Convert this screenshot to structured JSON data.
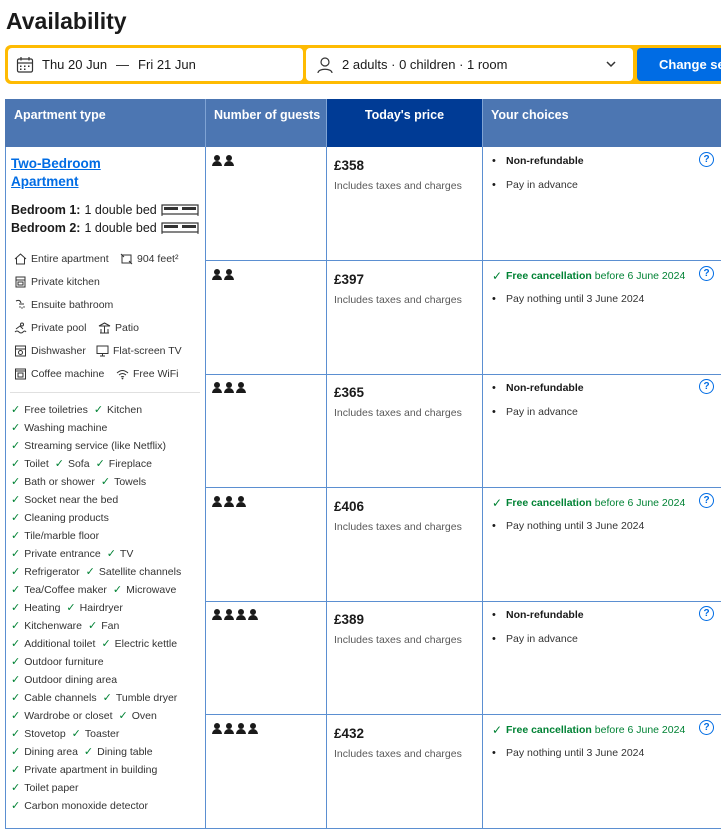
{
  "page": {
    "title": "Availability"
  },
  "search": {
    "checkin": "Thu 20 Jun",
    "separator": "—",
    "checkout": "Fri 21 Jun",
    "guests": "2 adults · 0 children · 1 room",
    "change_button": "Change search"
  },
  "table": {
    "headers": {
      "apartment_type": "Apartment type",
      "guests": "Number of guests",
      "price": "Today's price",
      "choices": "Your choices"
    }
  },
  "apartment": {
    "name": "Two-Bedroom Apartment",
    "beds": [
      {
        "label": "Bedroom 1:",
        "value": "1 double bed"
      },
      {
        "label": "Bedroom 2:",
        "value": "1 double bed"
      }
    ],
    "facilities": {
      "entire": "Entire apartment",
      "size": "904 feet²",
      "kitchen": "Private kitchen",
      "bathroom": "Ensuite bathroom",
      "pool": "Private pool",
      "patio": "Patio",
      "dishwasher": "Dishwasher",
      "tv": "Flat-screen TV",
      "coffee": "Coffee machine",
      "wifi": "Free WiFi"
    },
    "amenity_rows": [
      [
        "Free toiletries",
        "Kitchen"
      ],
      [
        "Washing machine"
      ],
      [
        "Streaming service (like Netflix)"
      ],
      [
        "Toilet",
        "Sofa",
        "Fireplace"
      ],
      [
        "Bath or shower",
        "Towels"
      ],
      [
        "Socket near the bed"
      ],
      [
        "Cleaning products"
      ],
      [
        "Tile/marble floor"
      ],
      [
        "Private entrance",
        "TV"
      ],
      [
        "Refrigerator",
        "Satellite channels"
      ],
      [
        "Tea/Coffee maker",
        "Microwave"
      ],
      [
        "Heating",
        "Hairdryer"
      ],
      [
        "Kitchenware",
        "Fan"
      ],
      [
        "Additional toilet",
        "Electric kettle"
      ],
      [
        "Outdoor furniture"
      ],
      [
        "Outdoor dining area"
      ],
      [
        "Cable channels",
        "Tumble dryer"
      ],
      [
        "Wardrobe or closet",
        "Oven"
      ],
      [
        "Stovetop",
        "Toaster"
      ],
      [
        "Dining area",
        "Dining table"
      ],
      [
        "Private apartment in building"
      ],
      [
        "Toilet paper"
      ],
      [
        "Carbon monoxide detector"
      ]
    ]
  },
  "common": {
    "taxes": "Includes taxes and charges",
    "non_refundable": "Non-refundable",
    "pay_advance": "Pay in advance",
    "free_cancel": "Free cancellation",
    "free_cancel_date": "before 6 June 2024",
    "pay_nothing": "Pay nothing until 3 June 2024",
    "info_symbol": "?"
  },
  "rows": [
    {
      "guests": 2,
      "price": "£358",
      "type": "nonref"
    },
    {
      "guests": 2,
      "price": "£397",
      "type": "free"
    },
    {
      "guests": 3,
      "price": "£365",
      "type": "nonref"
    },
    {
      "guests": 3,
      "price": "£406",
      "type": "free"
    },
    {
      "guests": 4,
      "price": "£389",
      "type": "nonref"
    },
    {
      "guests": 4,
      "price": "£432",
      "type": "free"
    }
  ],
  "colors": {
    "accent_yellow": "#febb02",
    "button_blue": "#006ce4",
    "header_blue": "#4c76b2",
    "price_header_blue": "#003b95",
    "green": "#008234"
  }
}
